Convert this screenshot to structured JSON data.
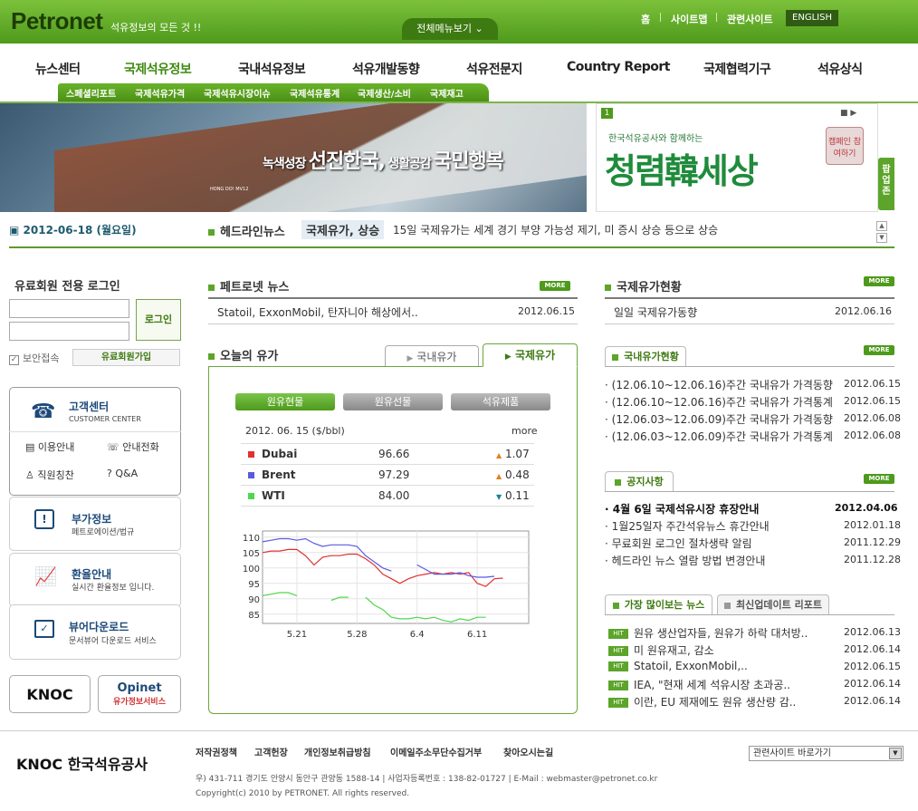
{
  "header": {
    "logo": "Petronet",
    "tagline": "석유정보의 모든 것 !!",
    "all_menu": "전체메뉴보기",
    "links": [
      "홈",
      "사이트맵",
      "관련사이트"
    ],
    "english": "ENGLISH"
  },
  "gnb": [
    "뉴스센터",
    "국제석유정보",
    "국내석유정보",
    "석유개발동향",
    "석유전문지",
    "Country Report",
    "국제협력기구",
    "석유상식"
  ],
  "subnav": [
    "스페셜리포트",
    "국제석유가격",
    "국제석유시장이슈",
    "국제석유통계",
    "국제생산/소비",
    "국제재고"
  ],
  "banner": {
    "slogan_a": "녹색성장",
    "slogan_b": "선진한국,",
    "slogan_c": "생활공감",
    "slogan_d": "국민행복",
    "ship_name": "HONG DO! MV12"
  },
  "promo": {
    "num": "1",
    "sub": "한국석유공사와 함께하는",
    "title": "청렴韓세상",
    "btn": "캠페인 참여하기",
    "popup": "팝업존"
  },
  "headline": {
    "date": "2012-06-18 (월요일)",
    "head": "헤드라인뉴스",
    "keyword": "국제유가, 상승",
    "text": "15일 국제유가는 세계 경기 부양 가능성 제기, 미 증시 상승 등으로 상승"
  },
  "login": {
    "title": "유료회원 전용 로그인",
    "btn": "로그인",
    "secure": "보안접속",
    "join": "유료회원가입"
  },
  "customer": {
    "title": "고객센터",
    "sub": "CUSTOMER CENTER",
    "items": [
      "이용안내",
      "안내전화",
      "직원칭찬",
      "Q&A"
    ]
  },
  "leftmenu": [
    {
      "title": "부가정보",
      "sub": "페트로에이션/법규"
    },
    {
      "title": "환율안내",
      "sub": "실시간 환율정보 입니다."
    },
    {
      "title": "뷰어다운로드",
      "sub": "문서뷰어 다운로드 서비스"
    }
  ],
  "partners": {
    "knoc": "KNOC",
    "opinet": "Opinet",
    "opinet_sub": "유가정보서비스"
  },
  "petronet_news": {
    "title": "페트로넷 뉴스",
    "more": "MORE",
    "item": "Statoil, ExxonMobil, 탄자니아 해상에서..",
    "date": "2012.06.15"
  },
  "oil": {
    "title": "오늘의 유가",
    "tabs": [
      "국내유가",
      "국제유가"
    ],
    "pills": [
      "원유현물",
      "원유선물",
      "석유제품"
    ],
    "date_label": "2012. 06. 15 ($/bbl)",
    "more": "more",
    "rows": [
      {
        "name": "Dubai",
        "price": "96.66",
        "change": "1.07",
        "dir": "up",
        "color": "#e03030"
      },
      {
        "name": "Brent",
        "price": "97.29",
        "change": "0.48",
        "dir": "up",
        "color": "#5a5ae0"
      },
      {
        "name": "WTI",
        "price": "84.00",
        "change": "0.11",
        "dir": "down",
        "color": "#4cd84c"
      }
    ]
  },
  "chart_data": {
    "type": "line",
    "ylim": [
      82,
      112
    ],
    "yticks": [
      85,
      90,
      95,
      100,
      105,
      110
    ],
    "xticks": [
      "5.21",
      "5.28",
      "6.4",
      "6.11"
    ],
    "xtick_idx": [
      4,
      11,
      18,
      25
    ],
    "n": 32,
    "series": [
      {
        "color": "#e03030",
        "values": [
          105,
          105.5,
          105.5,
          106,
          106,
          104,
          101,
          103.5,
          104,
          104,
          104.5,
          104.5,
          103,
          101,
          98,
          96.5,
          95,
          96.5,
          97.5,
          98,
          98.5,
          98,
          98.5,
          98,
          98.5,
          95,
          94,
          96.5,
          96.7,
          null,
          null,
          null
        ]
      },
      {
        "color": "#5a5ae0",
        "values": [
          108.5,
          109,
          109.5,
          109.5,
          109,
          109.5,
          108,
          107,
          107.5,
          107.5,
          107.5,
          107,
          104,
          102,
          100,
          99,
          null,
          null,
          101,
          99.5,
          98,
          98,
          98,
          98.5,
          97.5,
          97,
          97,
          97.3,
          null,
          null,
          null,
          null
        ]
      },
      {
        "color": "#4cd84c",
        "values": [
          91,
          91.5,
          92,
          92,
          91,
          null,
          90.5,
          null,
          89.5,
          90.5,
          90.5,
          null,
          90.5,
          88,
          86.5,
          84,
          83.5,
          83.5,
          84,
          83.5,
          84,
          83,
          82.5,
          83.5,
          83,
          84,
          84,
          null,
          null,
          null,
          null,
          null
        ]
      }
    ]
  },
  "intl_price": {
    "title": "국제유가현황",
    "more": "MORE",
    "item": "일일 국제유가동향",
    "date": "2012.06.16"
  },
  "domestic": {
    "tab": "국내유가현황",
    "more": "MORE",
    "items": [
      {
        "text": "(12.06.10~12.06.16)주간 국내유가 가격동향",
        "date": "2012.06.15"
      },
      {
        "text": "(12.06.10~12.06.16)주간 국내유가 가격통계",
        "date": "2012.06.15"
      },
      {
        "text": "(12.06.03~12.06.09)주간 국내유가 가격동향",
        "date": "2012.06.08"
      },
      {
        "text": "(12.06.03~12.06.09)주간 국내유가 가격통계",
        "date": "2012.06.08"
      }
    ]
  },
  "notice": {
    "tab": "공지사항",
    "more": "MORE",
    "items": [
      {
        "text": "4월 6일 국제석유시장 휴장안내",
        "date": "2012.04.06"
      },
      {
        "text": "1월25일자 주간석유뉴스 휴간안내",
        "date": "2012.01.18"
      },
      {
        "text": "무료회원 로그인 절차생략 알림",
        "date": "2011.12.29"
      },
      {
        "text": "헤드라인 뉴스 열람 방법 변경안내",
        "date": "2011.12.28"
      }
    ]
  },
  "popular": {
    "tabs": [
      "가장 많이보는 뉴스",
      "최신업데이트 리포트"
    ],
    "hit": "HIT",
    "items": [
      {
        "text": "원유 생산업자들, 원유가 하락 대처방..",
        "date": "2012.06.13"
      },
      {
        "text": "미 원유재고, 감소",
        "date": "2012.06.14"
      },
      {
        "text": "Statoil, ExxonMobil,..",
        "date": "2012.06.15"
      },
      {
        "text": "IEA, \"현재 세계 석유시장 초과공..",
        "date": "2012.06.14"
      },
      {
        "text": "이란, EU 제재에도 원유 생산량 감..",
        "date": "2012.06.14"
      }
    ]
  },
  "footer": {
    "links": [
      "저작권정책",
      "고객헌장",
      "개인정보취급방침",
      "이메일주소무단수집거부",
      "찾아오시는길"
    ],
    "select": "관련사이트 바로가기",
    "address": "우) 431-711 경기도 안양시 동안구 관양동 1588-14  |  사업자등록번호 : 138-82-01727  |  E-Mail : webmaster@petronet.co.kr",
    "copyright": "Copyright(c) 2010 by PETRONET. All rights reserved.",
    "knoc": "KNOC 한국석유공사"
  }
}
